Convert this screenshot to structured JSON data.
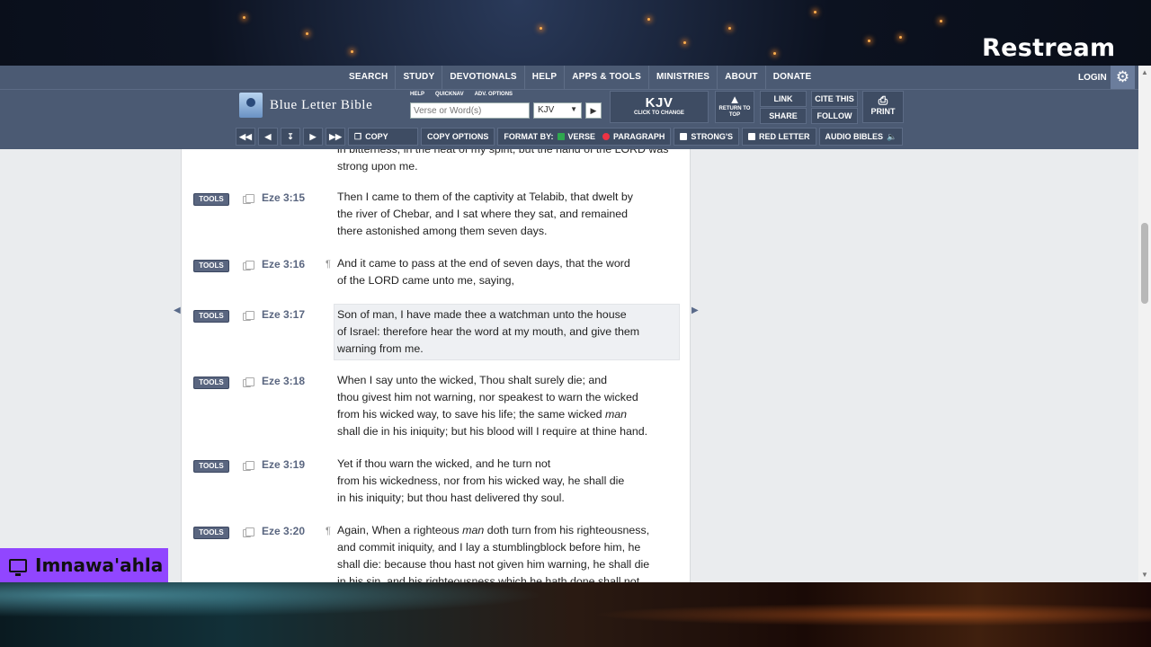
{
  "overlay": {
    "brand": "Restream",
    "username": "Imnawa'ahla"
  },
  "topnav": {
    "items": [
      "SEARCH",
      "STUDY",
      "DEVOTIONALS",
      "HELP",
      "APPS & TOOLS",
      "MINISTRIES",
      "ABOUT",
      "DONATE"
    ],
    "login": "LOGIN"
  },
  "header": {
    "logo_text": "Blue Letter Bible",
    "mini_links": [
      "HELP",
      "QUICKNAV",
      "ADV. OPTIONS"
    ],
    "search_placeholder": "Verse or Word(s)",
    "version_value": "KJV",
    "kjv_label": "KJV",
    "kjv_sub": "CLICK TO CHANGE",
    "return_top": "RETURN TO TOP",
    "link": "LINK",
    "share": "SHARE",
    "cite": "CITE THIS",
    "follow": "FOLLOW",
    "print": "PRINT"
  },
  "optbar": {
    "copy": "COPY",
    "copy_options": "COPY OPTIONS",
    "format_by": "FORMAT BY:",
    "verse": "VERSE",
    "paragraph": "PARAGRAPH",
    "strongs": "STRONG'S",
    "red_letter": "RED LETTER",
    "audio": "AUDIO BIBLES"
  },
  "partial_text": "in bitterness, in the heat of my spirit; but the hand of the LORD was strong upon me.",
  "tools_label": "TOOLS",
  "verses": [
    {
      "ref": "Eze 3:15",
      "para": false,
      "lines": [
        "Then I came to them of the captivity at Telabib, that dwelt by",
        "the river of Chebar, and I sat where they sat, and remained",
        "there astonished among them seven days."
      ]
    },
    {
      "ref": "Eze 3:16",
      "para": true,
      "lines": [
        "And it came to pass at the end of seven days, that the word",
        "of the LORD came unto me, saying,"
      ]
    },
    {
      "ref": "Eze 3:17",
      "para": false,
      "lines": [
        "Son of man, I have made thee a watchman unto the house",
        "of Israel: therefore hear the word at my mouth, and give them",
        "warning from me."
      ]
    },
    {
      "ref": "Eze 3:18",
      "para": false,
      "lines": [
        "When I say unto the wicked, Thou shalt surely die; and",
        "thou givest him not warning, nor speakest to warn the wicked",
        "from his wicked way, to save his life; the same wicked man",
        "shall die in his iniquity; but his blood will I require at thine hand."
      ]
    },
    {
      "ref": "Eze 3:19",
      "para": false,
      "lines": [
        "Yet if thou warn the wicked, and he turn not",
        "from his wickedness, nor from his wicked way, he shall die",
        "in his iniquity; but thou hast delivered thy soul."
      ]
    },
    {
      "ref": "Eze 3:20",
      "para": true,
      "lines": [
        "Again, When a righteous man doth turn from his righteousness,",
        "and commit iniquity, and I lay a stumblingblock before him, he",
        "shall die: because thou hast not given him warning, he shall die",
        "in his sin, and his righteousness which he hath done shall not"
      ]
    }
  ]
}
